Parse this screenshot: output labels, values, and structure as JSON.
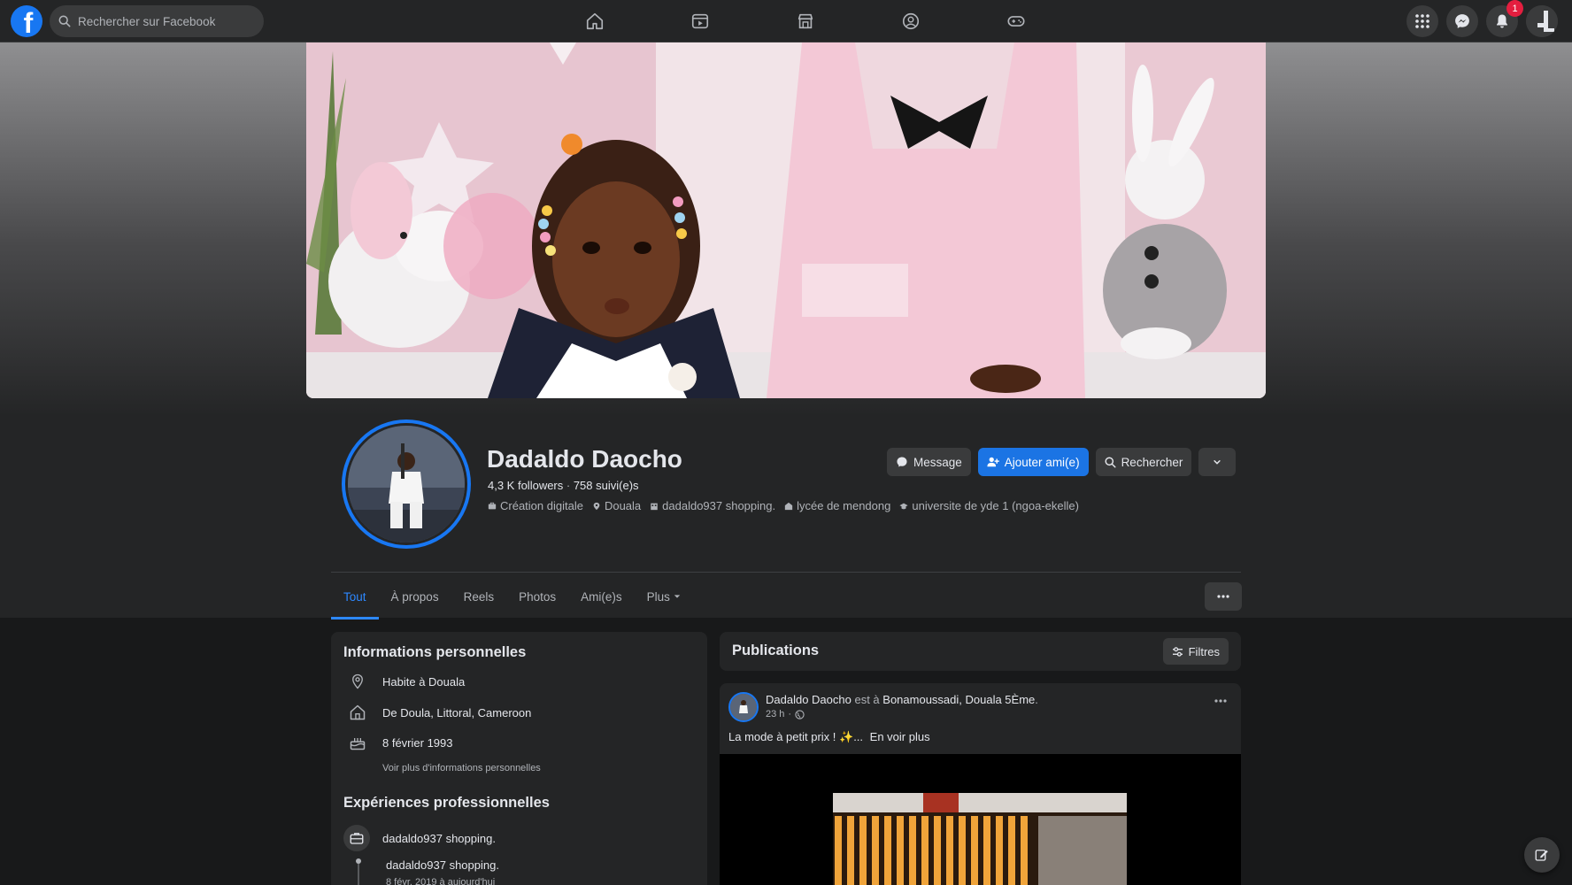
{
  "topbar": {
    "logo_letter": "f",
    "search_placeholder": "Rechercher sur Facebook",
    "nav_icons": [
      "home-icon",
      "video-icon",
      "marketplace-icon",
      "groups-icon",
      "gaming-icon"
    ],
    "right_icons": [
      "menu-grid-icon",
      "messenger-icon",
      "bell-icon"
    ],
    "notification_count": "1"
  },
  "profile": {
    "name": "Dadaldo Daocho",
    "followers": "4,3 K followers",
    "separator": " · ",
    "following": "758 suivi(e)s",
    "meta": [
      {
        "icon": "briefcase-icon",
        "text": "Création digitale"
      },
      {
        "icon": "location-icon",
        "text": "Douala"
      },
      {
        "icon": "work-icon",
        "text": "dadaldo937 shopping."
      },
      {
        "icon": "school-icon",
        "text": "lycée de mendong"
      },
      {
        "icon": "graduation-icon",
        "text": "universite de yde 1 (ngoa-ekelle)"
      }
    ],
    "actions": {
      "message": "Message",
      "add_friend": "Ajouter ami(e)",
      "search": "Rechercher"
    }
  },
  "tabs": [
    {
      "label": "Tout",
      "active": true
    },
    {
      "label": "À propos"
    },
    {
      "label": "Reels"
    },
    {
      "label": "Photos"
    },
    {
      "label": "Ami(e)s"
    },
    {
      "label": "Plus"
    }
  ],
  "personal_info": {
    "title": "Informations personnelles",
    "rows": [
      {
        "icon": "location-pin-icon",
        "text": "Habite à Douala"
      },
      {
        "icon": "house-icon",
        "text": "De Doula, Littoral, Cameroon"
      },
      {
        "icon": "birthday-cake-icon",
        "text": "8 février 1993"
      }
    ],
    "see_more": "Voir plus d'informations personnelles"
  },
  "work": {
    "title": "Expériences professionnelles",
    "rows": [
      {
        "text": "dadaldo937 shopping."
      },
      {
        "text": "dadaldo937 shopping.",
        "sub": "8 févr. 2019 à aujourd'hui"
      }
    ]
  },
  "publications": {
    "title": "Publications",
    "filter_label": "Filtres",
    "post": {
      "author": "Dadaldo Daocho",
      "is_at": " est à ",
      "place": "Bonamoussadi, Douala 5Ème",
      "period": ".",
      "time": "23 h",
      "text": "La mode à petit prix ! ✨...",
      "see_more": "En voir plus"
    }
  },
  "colors": {
    "accent": "#1877f2",
    "active_tab": "#2d88ff",
    "surface": "#242526",
    "background": "#18191a"
  }
}
